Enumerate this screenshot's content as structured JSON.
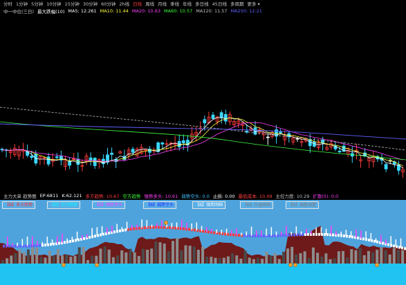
{
  "period_tabs": [
    {
      "label": "分时",
      "active": false
    },
    {
      "label": "1分钟",
      "active": false
    },
    {
      "label": "5分钟",
      "active": false
    },
    {
      "label": "10分钟",
      "active": false
    },
    {
      "label": "15分钟",
      "active": false
    },
    {
      "label": "30分钟",
      "active": false
    },
    {
      "label": "60分钟",
      "active": false
    },
    {
      "label": "2h线",
      "active": false
    },
    {
      "label": "日线",
      "active": true
    },
    {
      "label": "周线",
      "active": false
    },
    {
      "label": "月线",
      "active": false
    },
    {
      "label": "季线",
      "active": false
    },
    {
      "label": "年线",
      "active": false
    },
    {
      "label": "多日线",
      "active": false
    },
    {
      "label": "45日线",
      "active": false
    },
    {
      "label": "多周期",
      "active": false
    },
    {
      "label": "更多 ▾",
      "active": false
    }
  ],
  "ma_bar": [
    {
      "text": "中一中位(三日)",
      "color": "#d0d0d0"
    },
    {
      "text": "最大跌幅(10)",
      "color": "#ffffff"
    },
    {
      "text": "MA5: 12.261",
      "color": "#ffffff"
    },
    {
      "text": "MA10: 11.44",
      "color": "#ffff40"
    },
    {
      "text": "MA20: 10.63",
      "color": "#ff40ff"
    },
    {
      "text": "MA60: 10.57",
      "color": "#40ff40"
    },
    {
      "text": "MA120: 11.57",
      "color": "#c0c0c0"
    },
    {
      "text": "MA250: 12.21",
      "color": "#6060ff"
    }
  ],
  "indicator_bar": [
    {
      "text": "主力大单 趋势图",
      "color": "#d0d0d0"
    },
    {
      "text": "EP:6811",
      "color": "#ffffff"
    },
    {
      "text": "K:62.121",
      "color": "#ffffff"
    },
    {
      "text": "多方趋势: 10.67",
      "color": "#ff4040"
    },
    {
      "text": "空方趋势",
      "color": "#40ff40"
    },
    {
      "text": "强势多头: 10.61",
      "color": "#ff40ff"
    },
    {
      "text": "弱势空头: 0.0",
      "color": "#40c0ff"
    },
    {
      "text": "止损: 0.00",
      "color": "#ffffff"
    },
    {
      "text": "最低成本: 10.09",
      "color": "#ff4040"
    },
    {
      "text": "主控力度: 10.29",
      "color": "#c0c0c0"
    },
    {
      "text": "扩散(5): 0.0",
      "color": "#ff40ff"
    }
  ],
  "sub_legend": [
    {
      "text": "【B】多方趋势",
      "color": "#ff2a2a"
    },
    {
      "text": "【B】空方趋势",
      "color": "#00ffff"
    },
    {
      "text": "【B】强势多头",
      "color": "#ff40ff"
    },
    {
      "text": "【B】弱势空头",
      "color": "#2020ff"
    },
    {
      "text": "【B】强势回档",
      "color": "#ffffff"
    },
    {
      "text": "【B】升温回档",
      "color": "#7a7a7a"
    },
    {
      "text": "【B】调整调整",
      "color": "#7a7a7a"
    }
  ],
  "colors": {
    "up": "#ff3b3b",
    "down": "#3ad7ff",
    "flat": "#ffffff",
    "ma5": "#ffffff",
    "ma10": "#ffff40",
    "ma20": "#ff40ff",
    "ma60": "#40ff40",
    "ma120": "#c0c0c0",
    "ma250": "#6060ff",
    "sub_bg": "#4fa3dc",
    "cyan_band": "#21c3f2",
    "maroon": "#6e1a1a",
    "grey": "#8c8c8c",
    "dark_grey": "#4a4a4a",
    "orange": "#f7a532"
  },
  "icons": [
    "marker-icon"
  ]
}
